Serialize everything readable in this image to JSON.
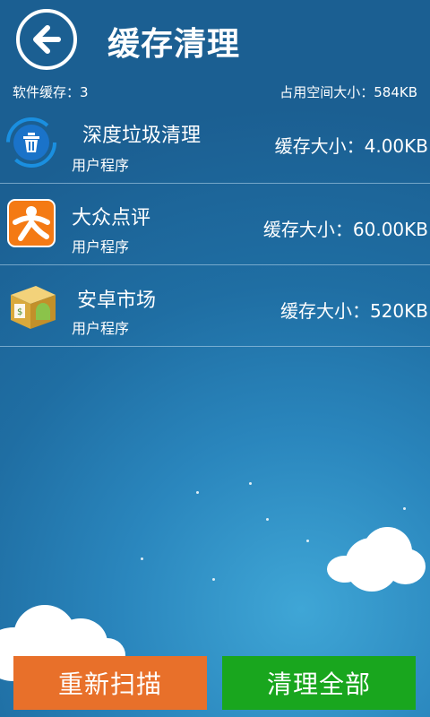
{
  "header": {
    "title": "缓存清理"
  },
  "summary": {
    "software_cache": "软件缓存：3",
    "occupied_space": "占用空间大小：584KB"
  },
  "items": [
    {
      "name": "深度垃圾清理",
      "type": "用户程序",
      "size": "缓存大小：4.00KB",
      "icon": "trash-icon"
    },
    {
      "name": "大众点评",
      "type": "用户程序",
      "size": "缓存大小：60.00KB",
      "icon": "dianping-icon"
    },
    {
      "name": "安卓市场",
      "type": "用户程序",
      "size": "缓存大小：520KB",
      "icon": "android-market-icon"
    }
  ],
  "buttons": {
    "rescan": "重新扫描",
    "clear_all": "清理全部"
  },
  "colors": {
    "rescan": "#e8702a",
    "clear_all": "#19a61e"
  }
}
